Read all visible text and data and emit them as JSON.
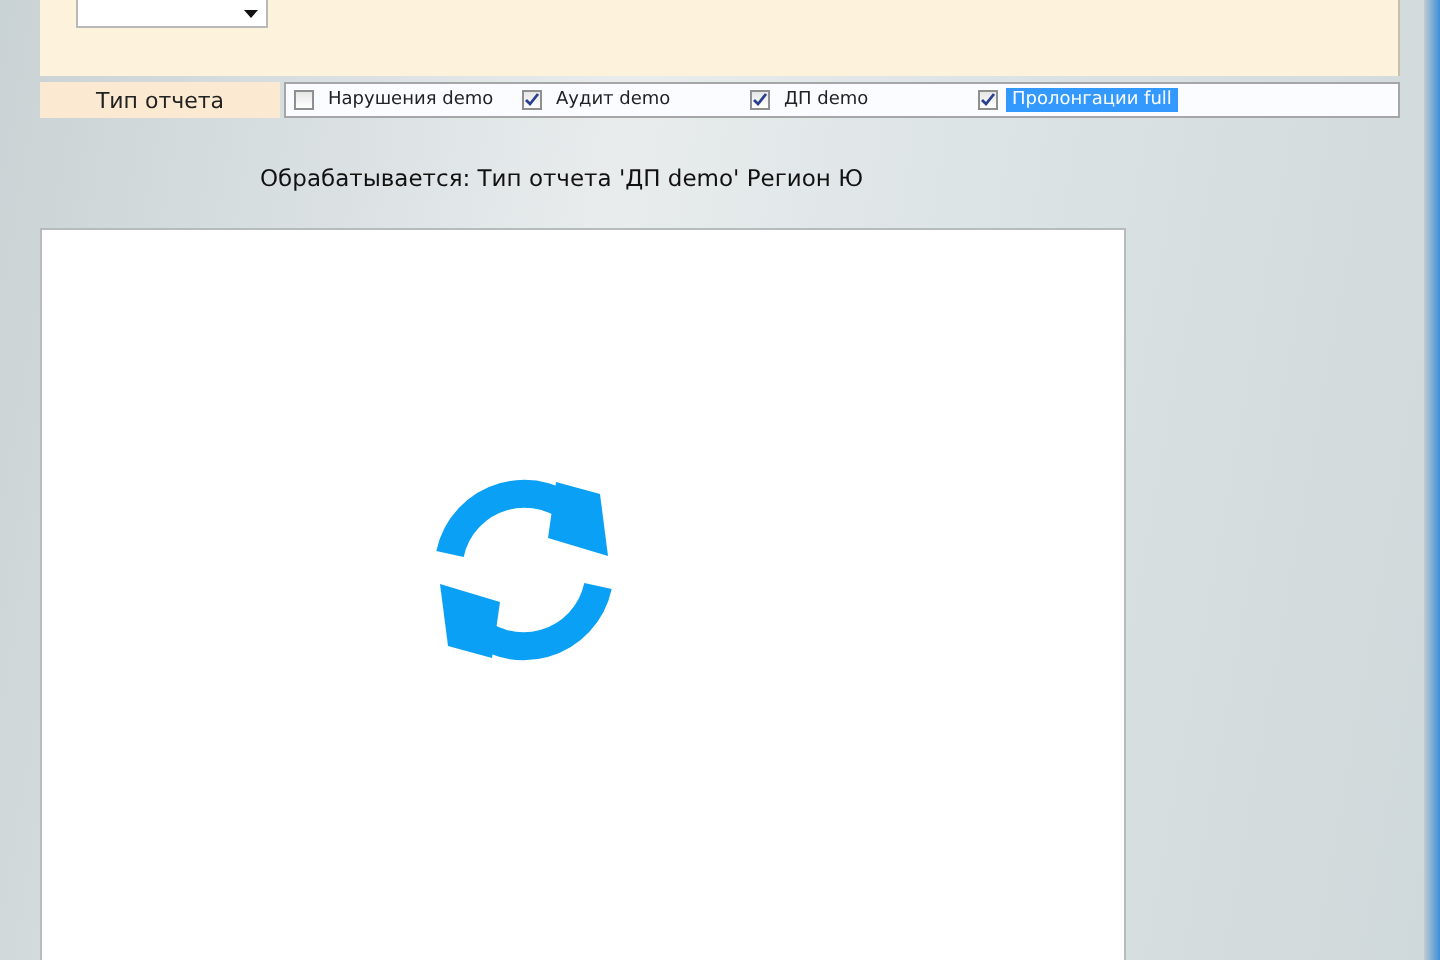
{
  "filter": {
    "label": "Тип отчета",
    "options": [
      {
        "label": "Нарушения demo",
        "checked": false,
        "selected": false
      },
      {
        "label": "Аудит demo",
        "checked": true,
        "selected": false
      },
      {
        "label": "ДП demo",
        "checked": true,
        "selected": false
      },
      {
        "label": "Пролонгации full",
        "checked": true,
        "selected": true
      }
    ]
  },
  "status": "Обрабатывается: Тип отчета 'ДП demo' Регион Ю"
}
